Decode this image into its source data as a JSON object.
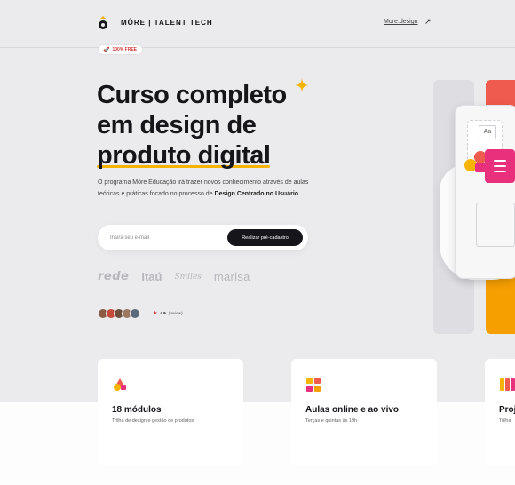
{
  "header": {
    "brand": "MÔRE | TALENT TECH",
    "nav_link": "More.design",
    "nav_arrow_icon": "arrow-up-right-icon"
  },
  "badge": {
    "label": "100% FREE",
    "icon": "rocket-icon"
  },
  "hero": {
    "title_line1": "Curso completo",
    "title_line2": "em design de",
    "title_line3": "produto digital",
    "desc_text": "O programa Môre Educação irá trazer novos conhecimento através de aulas teóricas e práticas focado no processo de",
    "desc_bold": "Design Centrado no Usuário"
  },
  "signup": {
    "placeholder": "Insira seu e-mail",
    "button_label": "Realizar pré-cadastro"
  },
  "partners": [
    "rede",
    "Itaú",
    "Smiles",
    "marisa"
  ],
  "rating": {
    "score": "4.9",
    "label": "(review)"
  },
  "illustration": {
    "card_label": "Aa"
  },
  "features": [
    {
      "title": "18 módulos",
      "subtitle": "Trilha de design e gestão de produtos"
    },
    {
      "title": "Aulas online e ao vivo",
      "subtitle": "Terças e quintas às 19h"
    },
    {
      "title": "Proj",
      "subtitle": "Trilha"
    }
  ],
  "colors": {
    "accent_yellow": "#f6b400",
    "accent_pink": "#e8307d",
    "accent_red": "#ef5b4c",
    "dark": "#16161a"
  }
}
